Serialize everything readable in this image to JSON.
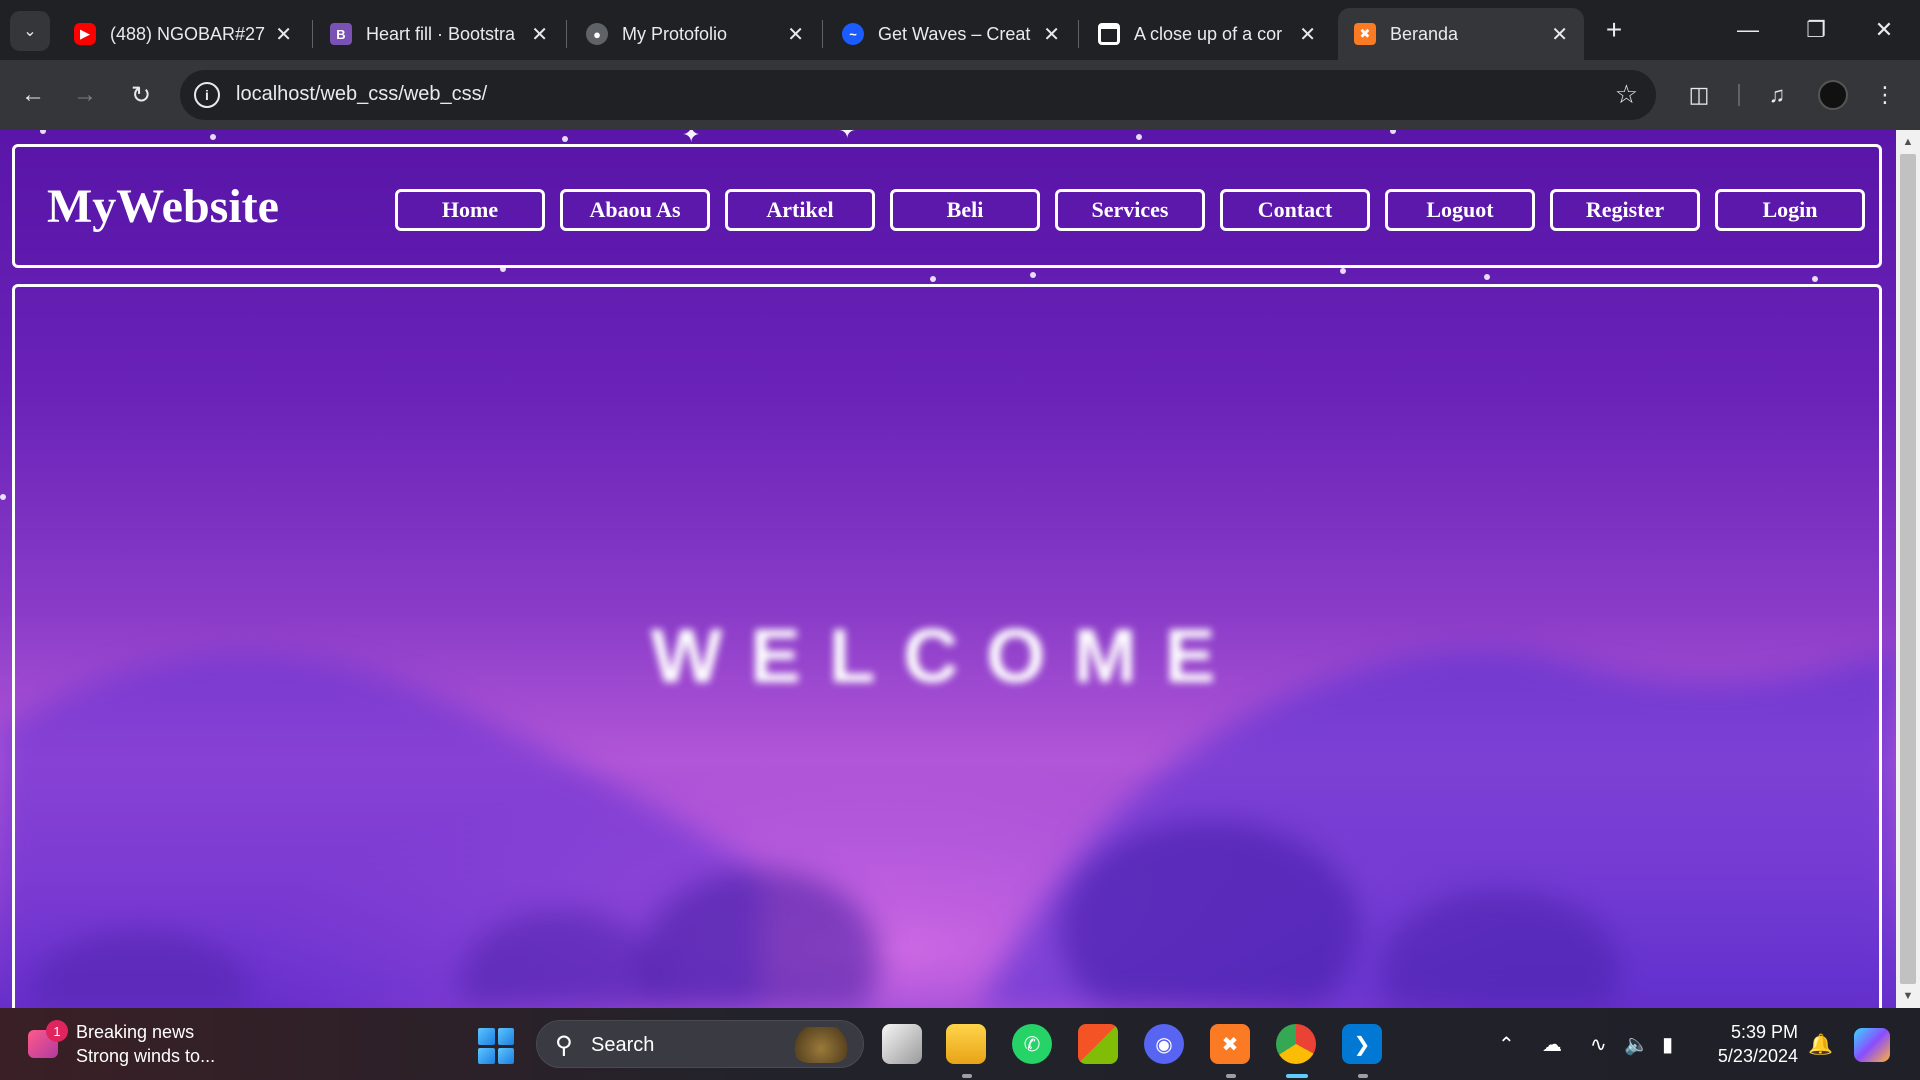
{
  "browser": {
    "tabs": [
      {
        "title": "(488) NGOBAR#27",
        "favicon": "youtube-icon",
        "color": "#ff0000"
      },
      {
        "title": "Heart fill · Bootstra",
        "favicon": "bootstrap-icon",
        "color": "#7952b3",
        "glyph": "B"
      },
      {
        "title": "My Protofolio",
        "favicon": "globe-icon",
        "color": "#9aa0a6"
      },
      {
        "title": "Get Waves – Creat",
        "favicon": "waves-icon",
        "color": "#1a5cff"
      },
      {
        "title": "A close up of a cor",
        "favicon": "unsplash-icon",
        "color": "#ffffff"
      },
      {
        "title": "Beranda",
        "favicon": "xampp-icon",
        "color": "#fb7a24",
        "active": true
      }
    ],
    "url": "localhost/web_css/web_css/"
  },
  "site": {
    "logo": "MyWebsite",
    "nav": [
      "Home",
      "Abaou As",
      "Artikel",
      "Beli",
      "Services",
      "Contact",
      "Loguot",
      "Register",
      "Login"
    ],
    "hero_text": "WELCOME"
  },
  "taskbar": {
    "news_badge": "1",
    "news_title": "Breaking news",
    "news_subtitle": "Strong winds to...",
    "search_label": "Search",
    "time": "5:39 PM",
    "date": "5/23/2024"
  },
  "colors": {
    "brand_purple": "#5a16a8",
    "accent_pink": "#c66ae0",
    "border_white": "#ffffff"
  }
}
